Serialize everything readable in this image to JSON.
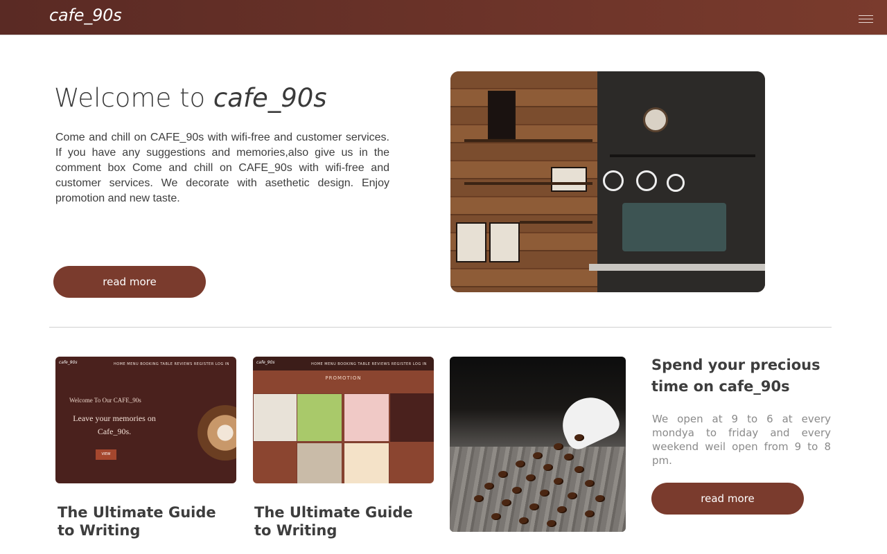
{
  "nav": {
    "brand": "cafe_90s",
    "menu_icon": "hamburger-icon"
  },
  "hero": {
    "title_prefix": "Welcome to ",
    "title_emphasis": "cafe_90s",
    "text": "Come and chill on CAFE_90s with wifi-free and customer services. If you have any suggestions and memories,also give us in the comment box Come and chill on CAFE_90s with wifi-free and customer services. We decorate with asethetic design. Enjoy promotion and new taste.",
    "button_label": "read more"
  },
  "cards": [
    {
      "title": "The Ultimate Guide to Writing",
      "preview": {
        "logo": "cafe_90s",
        "nav": "HOME  MENU  BOOKING TABLE  REVIEWS  REGISTER  LOG IN",
        "welcome": "Welcome To Our CAFE_90s",
        "headline": "Leave your memories on Cafe_90s.",
        "button": "VIEW"
      }
    },
    {
      "title": "The Ultimate Guide to Writing",
      "preview": {
        "logo": "cafe_90s",
        "nav": "HOME  MENU  BOOKING TABLE  REVIEWS  REGISTER  LOG IN",
        "promo": "PROMOTION"
      }
    }
  ],
  "side": {
    "title": "Spend your precious time on cafe_90s",
    "text": "We open at 9 to 6 at every mondya to friday and every weekend weil open from 9 to 8 pm.",
    "button_label": "read more"
  },
  "colors": {
    "primary": "#7a3b2d",
    "nav_bg": "#5a2a24",
    "text": "#3d3d3d",
    "muted": "#8a8a8a"
  }
}
